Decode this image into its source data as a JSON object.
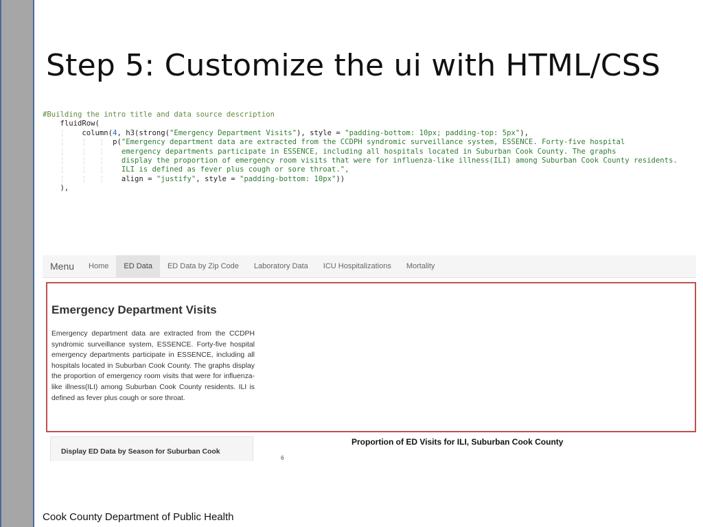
{
  "slide": {
    "title": "Step 5: Customize the ui with HTML/CSS",
    "footer": "Cook County Department of Public Health"
  },
  "code": {
    "comment": "#Building the intro title and data source description",
    "fluid_row": "fluidRow(",
    "column_call": "column(",
    "column_width": "4",
    "h3_call": ", h3(strong(",
    "heading_text": "\"Emergency Department Visits\"",
    "style_kw": "), style = ",
    "style1": "\"padding-bottom: 10px; padding-top: 5px\"",
    "p_call": "p(",
    "para_line1": "\"Emergency department data are extracted from the CCDPH syndromic surveillance system, ESSENCE. Forty-five hospital",
    "para_line2": "emergency departments participate in ESSENCE, including all hospitals located in Suburban Cook County. The graphs",
    "para_line3": "display the proportion of emergency room visits that were for influenza-like illness(ILI) among Suburban Cook County residents.",
    "para_line4": "ILI is defined as fever plus cough or sore throat.\",",
    "align_kw": "align = ",
    "align_val": "\"justify\"",
    "style_kw2": ", style = ",
    "style2": "\"padding-bottom: 10px\"",
    "close_p": "))",
    "close_row": "),"
  },
  "app": {
    "brand": "Menu",
    "tabs": [
      {
        "label": "Home"
      },
      {
        "label": "ED Data"
      },
      {
        "label": "ED Data by Zip Code"
      },
      {
        "label": "Laboratory Data"
      },
      {
        "label": "ICU Hospitalizations"
      },
      {
        "label": "Mortality"
      }
    ],
    "active_tab": "ED Data",
    "heading": "Emergency Department Visits",
    "description": "Emergency department data are extracted from the CCDPH syndromic surveillance system, ESSENCE. Forty-five hospital emergency departments participate in ESSENCE, including all hospitals located in Suburban Cook County. The graphs display the proportion of emergency room visits that were for influenza-like illness(ILI) among Suburban Cook County residents. ILI is defined as fever plus cough or sore throat.",
    "sidebar_panel_label": "Display ED Data by Season for Suburban Cook",
    "plot_title": "Proportion of ED Visits for ILI, Suburban Cook County",
    "plot_tick": "6"
  },
  "colors": {
    "highlight_border": "#c0504d",
    "side_bar": "#a6a6a6",
    "code_string": "#2e7d32",
    "code_number": "#1565c0"
  }
}
